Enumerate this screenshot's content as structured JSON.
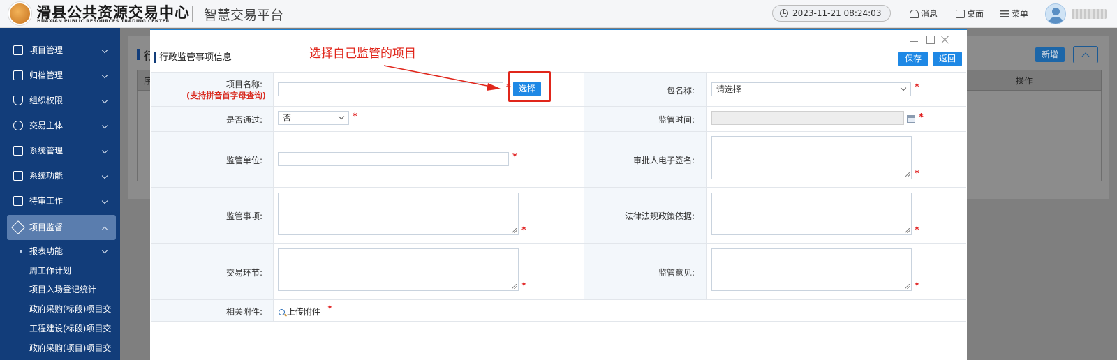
{
  "header": {
    "logo_cn": "滑县公共资源交易中心",
    "logo_en": "HUAXIAN PUBLIC RESOURCES TRADING CENTER",
    "platform_name": "智慧交易平台",
    "datetime": "2023-11-21 08:24:03",
    "messages_label": "消息",
    "desktop_label": "桌面",
    "menu_label": "菜单"
  },
  "sidebar": {
    "items": [
      {
        "label": "项目管理",
        "icon": "project-list-icon"
      },
      {
        "label": "归档管理",
        "icon": "archive-icon"
      },
      {
        "label": "组织权限",
        "icon": "shield-icon"
      },
      {
        "label": "交易主体",
        "icon": "users-icon"
      },
      {
        "label": "系统管理",
        "icon": "list-settings-icon"
      },
      {
        "label": "系统功能",
        "icon": "monitor-icon"
      },
      {
        "label": "待审工作",
        "icon": "calendar-icon"
      },
      {
        "label": "项目监督",
        "icon": "gavel-icon"
      }
    ],
    "sub_group": "报表功能",
    "sub_items": [
      "周工作计划",
      "项目入场登记统计",
      "政府采购(标段)项目交",
      "工程建设(标段)项目交",
      "政府采购(项目)项目交"
    ]
  },
  "background": {
    "section_char": "行",
    "seq_header": "序",
    "op_header": "操作",
    "add_button": "新增"
  },
  "modal": {
    "title": "行政监管事项信息",
    "save_button": "保存",
    "back_button": "返回",
    "fields": {
      "project_name_label": "项目名称:",
      "project_name_hint": "(支持拼音首字母查询)",
      "project_name_value": "",
      "select_button": "选择",
      "package_label": "包名称:",
      "package_value": "请选择",
      "passed_label": "是否通过:",
      "passed_value": "否",
      "supervise_time_label": "监管时间:",
      "supervise_time_value": "",
      "supervise_unit_label": "监管单位:",
      "supervise_unit_value": "",
      "approver_sign_label": "审批人电子签名:",
      "supervise_item_label": "监管事项:",
      "law_basis_label": "法律法规政策依据:",
      "trade_stage_label": "交易环节:",
      "supervise_opinion_label": "监管意见:",
      "attachment_label": "相关附件:",
      "upload_label": "上传附件",
      "required_mark": "*"
    }
  },
  "annotation": {
    "text": "选择自己监管的项目",
    "color": "#e0261b"
  }
}
